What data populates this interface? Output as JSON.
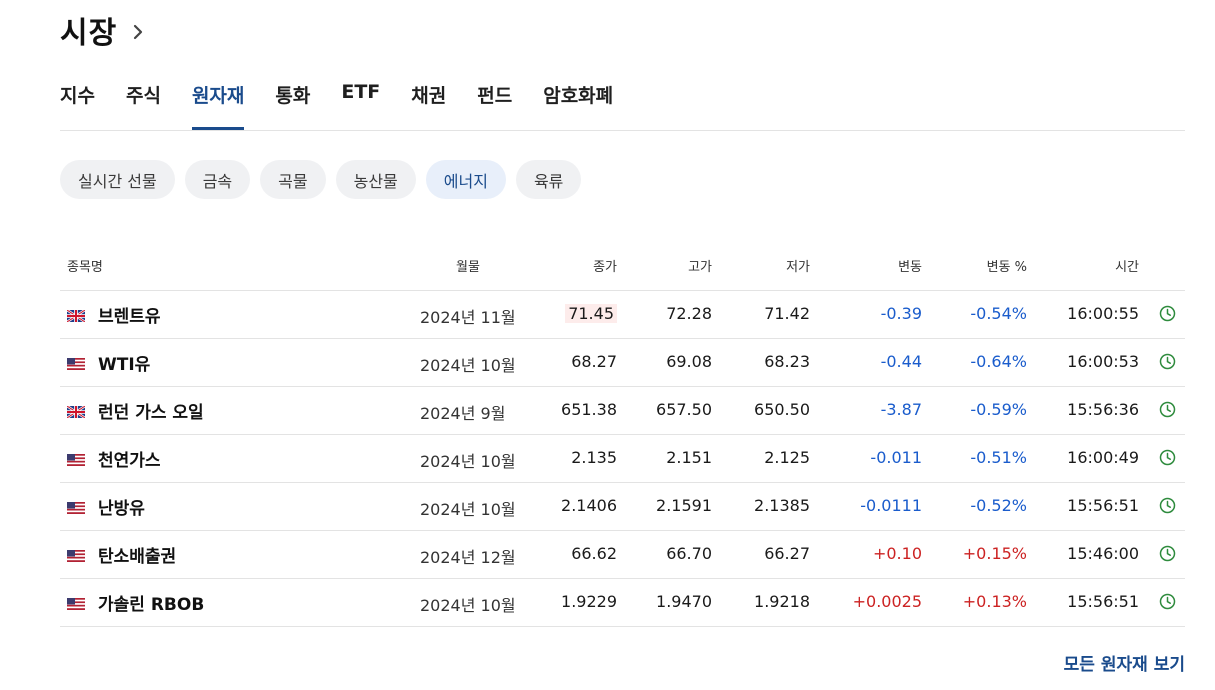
{
  "header": {
    "title": "시장"
  },
  "tabs": [
    {
      "label": "지수"
    },
    {
      "label": "주식"
    },
    {
      "label": "원자재",
      "active": true
    },
    {
      "label": "통화"
    },
    {
      "label": "ETF"
    },
    {
      "label": "채권"
    },
    {
      "label": "펀드"
    },
    {
      "label": "암호화폐"
    }
  ],
  "chips": [
    {
      "label": "실시간 선물"
    },
    {
      "label": "금속"
    },
    {
      "label": "곡물"
    },
    {
      "label": "농산물"
    },
    {
      "label": "에너지",
      "active": true
    },
    {
      "label": "육류"
    }
  ],
  "table": {
    "columns": {
      "name": "종목명",
      "month": "월물",
      "close": "종가",
      "high": "고가",
      "low": "저가",
      "change": "변동",
      "change_pct": "변동 %",
      "time": "시간"
    },
    "rows": [
      {
        "flag": "uk",
        "name": "브렌트유",
        "month": "2024년 11월",
        "close": "71.45",
        "high": "72.28",
        "low": "71.42",
        "change": "-0.39",
        "change_pct": "-0.54%",
        "time": "16:00:55",
        "direction": "down",
        "highlight": true
      },
      {
        "flag": "us",
        "name": "WTI유",
        "month": "2024년 10월",
        "close": "68.27",
        "high": "69.08",
        "low": "68.23",
        "change": "-0.44",
        "change_pct": "-0.64%",
        "time": "16:00:53",
        "direction": "down"
      },
      {
        "flag": "uk",
        "name": "런던 가스 오일",
        "month": "2024년 9월",
        "close": "651.38",
        "high": "657.50",
        "low": "650.50",
        "change": "-3.87",
        "change_pct": "-0.59%",
        "time": "15:56:36",
        "direction": "down"
      },
      {
        "flag": "us",
        "name": "천연가스",
        "month": "2024년 10월",
        "close": "2.135",
        "high": "2.151",
        "low": "2.125",
        "change": "-0.011",
        "change_pct": "-0.51%",
        "time": "16:00:49",
        "direction": "down"
      },
      {
        "flag": "us",
        "name": "난방유",
        "month": "2024년 10월",
        "close": "2.1406",
        "high": "2.1591",
        "low": "2.1385",
        "change": "-0.0111",
        "change_pct": "-0.52%",
        "time": "15:56:51",
        "direction": "down"
      },
      {
        "flag": "us",
        "name": "탄소배출권",
        "month": "2024년 12월",
        "close": "66.62",
        "high": "66.70",
        "low": "66.27",
        "change": "+0.10",
        "change_pct": "+0.15%",
        "time": "15:46:00",
        "direction": "up"
      },
      {
        "flag": "us",
        "name": "가솔린 RBOB",
        "month": "2024년 10월",
        "close": "1.9229",
        "high": "1.9470",
        "low": "1.9218",
        "change": "+0.0025",
        "change_pct": "+0.13%",
        "time": "15:56:51",
        "direction": "up"
      }
    ]
  },
  "footer": {
    "more_label": "모든 원자재 보기"
  },
  "colors": {
    "accent": "#1a4b8c",
    "negative": "#1a5ccc",
    "positive": "#cc2222",
    "clock": "#2e8b3d"
  },
  "icons": {
    "header_chevron": "chevron-right-icon",
    "row_clock": "clock-icon",
    "uk_flag": "uk-flag-icon",
    "us_flag": "us-flag-icon"
  }
}
